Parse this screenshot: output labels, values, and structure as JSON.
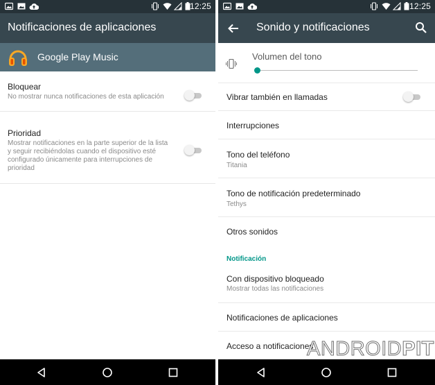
{
  "statusbar": {
    "time": "12:25"
  },
  "left_screen": {
    "title": "Notificaciones de aplicaciones",
    "app": {
      "name": "Google Play Music",
      "icon": "headphones-icon",
      "icon_color": "#f9a825"
    },
    "settings": [
      {
        "title": "Bloquear",
        "summary": "No mostrar nunca notificaciones de esta aplicación",
        "enabled": false
      },
      {
        "title": "Prioridad",
        "summary": "Mostrar notificaciones en la parte superior de la lista y seguir recibiéndolas cuando el dispositivo esté configurado únicamente para interrupciones de prioridad",
        "enabled": false
      }
    ]
  },
  "right_screen": {
    "title": "Sonido y notificaciones",
    "volume": {
      "label": "Volumen del tono",
      "level": 0.0,
      "icon": "vibrate-icon"
    },
    "items": [
      {
        "title": "Vibrar también en llamadas",
        "enabled": false
      },
      {
        "title": "Interrupciones"
      },
      {
        "title": "Tono del teléfono",
        "subtitle": "Titania"
      },
      {
        "title": "Tono de notificación predeterminado",
        "subtitle": "Tethys"
      },
      {
        "title": "Otros sonidos"
      }
    ],
    "notification_section": {
      "header": "Notificación",
      "items": [
        {
          "title": "Con dispositivo bloqueado",
          "subtitle": "Mostrar todas las notificaciones"
        },
        {
          "title": "Notificaciones de aplicaciones"
        },
        {
          "title": "Acceso a notificaciones"
        }
      ]
    }
  },
  "watermark": {
    "part1": "ANDROID",
    "part2": "PIT"
  },
  "colors": {
    "statusbar": "#263238",
    "appbar": "#37474f",
    "app_header": "#546e7a",
    "accent": "#009688"
  }
}
